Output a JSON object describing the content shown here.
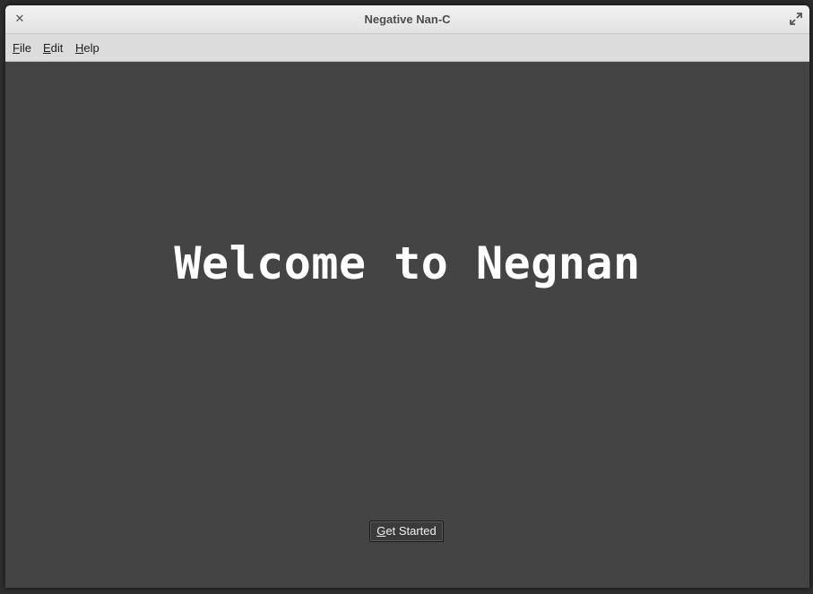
{
  "window": {
    "title": "Negative Nan-C",
    "close_glyph": "✕",
    "close_icon": "close-icon",
    "maximize_icon": "maximize-icon"
  },
  "menubar": {
    "items": [
      {
        "mnemonic": "F",
        "rest": "ile"
      },
      {
        "mnemonic": "E",
        "rest": "dit"
      },
      {
        "mnemonic": "H",
        "rest": "elp"
      }
    ]
  },
  "main": {
    "welcome_text": "Welcome to Negnan",
    "button": {
      "mnemonic": "G",
      "rest": "et Started"
    }
  },
  "colors": {
    "content_bg": "#444444",
    "titlebar_bg": "#e8e8e8",
    "menubar_bg": "#dcdcdc",
    "welcome_text": "#ffffff"
  }
}
